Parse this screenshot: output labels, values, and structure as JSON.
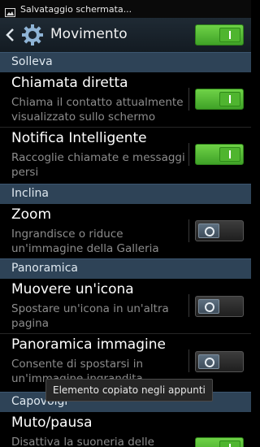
{
  "status_bar": {
    "notification_icon": "image-icon",
    "text": "Salvataggio schermata..."
  },
  "header": {
    "title": "Movimento",
    "master_switch": "on"
  },
  "sections": {
    "solleva": "Solleva",
    "inclina": "Inclina",
    "panoramica": "Panoramica",
    "capovolgi": "Capovolgi"
  },
  "items": {
    "chiamata_diretta": {
      "title": "Chiamata diretta",
      "sub1": "Chiama il contatto attualmente",
      "sub2": "visualizzato sullo schermo",
      "state": "on"
    },
    "notifica_intelligente": {
      "title": "Notifica Intelligente",
      "sub1": "Raccoglie chiamate e messaggi",
      "sub2": "persi",
      "state": "on"
    },
    "zoom": {
      "title": "Zoom",
      "sub1": "Ingrandisce o riduce",
      "sub2": "un'immagine della Galleria",
      "state": "off"
    },
    "muovere_icona": {
      "title": "Muovere un'icona",
      "sub1": "Spostare un'icona in un'altra",
      "sub2": "pagina",
      "state": "off"
    },
    "panoramica_immagine": {
      "title": "Panoramica immagine",
      "sub1": "Consente di spostarsi in",
      "sub2": "un'immagine ingrandita",
      "state": "off"
    },
    "muto_pausa": {
      "title": "Muto/pausa",
      "sub1": "Disattiva la suoneria delle",
      "state": "on"
    }
  },
  "toast": {
    "text": "Elemento copiato negli appunti"
  },
  "colors": {
    "accent_on": "#4fb52f",
    "section_bg": "#2e4357",
    "background": "#000000"
  }
}
